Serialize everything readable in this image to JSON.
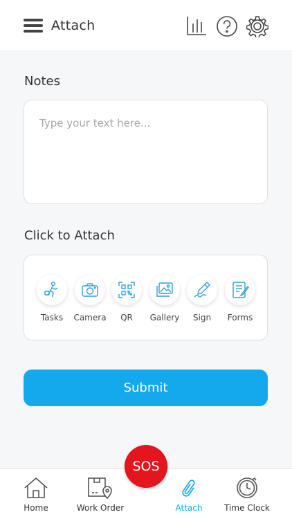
{
  "header": {
    "title": "Attach",
    "icons": [
      "menu-icon",
      "bar-chart-icon",
      "help-icon",
      "gear-icon"
    ]
  },
  "notes": {
    "label": "Notes",
    "placeholder": "Type your text here..."
  },
  "attach": {
    "label": "Click to Attach",
    "items": [
      {
        "label": "Tasks",
        "icon": "tasks-icon"
      },
      {
        "label": "Camera",
        "icon": "camera-icon"
      },
      {
        "label": "QR",
        "icon": "qr-code-icon"
      },
      {
        "label": "Gallery",
        "icon": "gallery-icon"
      },
      {
        "label": "Sign",
        "icon": "pen-icon"
      },
      {
        "label": "Forms",
        "icon": "forms-icon"
      }
    ]
  },
  "submit_label": "Submit",
  "sos_label": "SOS",
  "bottom_nav": [
    {
      "label": "Home",
      "icon": "home-icon"
    },
    {
      "label": "Work Order",
      "icon": "work-order-icon"
    },
    {
      "label": "Attach",
      "icon": "paperclip-icon"
    },
    {
      "label": "Time Clock",
      "icon": "clock-icon"
    }
  ],
  "colors": {
    "accent": "#14a9ec",
    "sos": "#e3161e",
    "icon_blue": "#2f9fd8"
  }
}
